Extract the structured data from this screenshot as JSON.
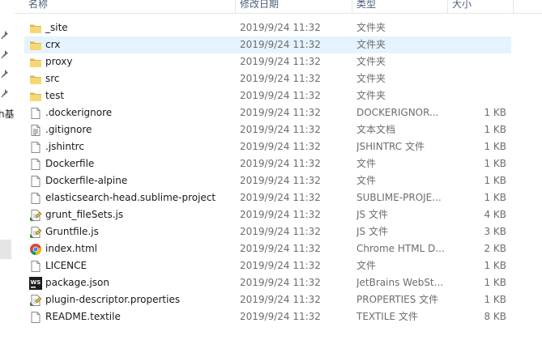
{
  "nav": {
    "cut_label": "h基"
  },
  "columns": {
    "name": "名称",
    "date": "修改日期",
    "type": "类型",
    "size": "大小"
  },
  "files": [
    {
      "name": "_site",
      "date": "2019/9/24 11:32",
      "type": "文件夹",
      "size": "",
      "icon": "folder-icon"
    },
    {
      "name": "crx",
      "date": "2019/9/24 11:32",
      "type": "文件夹",
      "size": "",
      "icon": "folder-icon",
      "selected": true
    },
    {
      "name": "proxy",
      "date": "2019/9/24 11:32",
      "type": "文件夹",
      "size": "",
      "icon": "folder-icon"
    },
    {
      "name": "src",
      "date": "2019/9/24 11:32",
      "type": "文件夹",
      "size": "",
      "icon": "folder-icon"
    },
    {
      "name": "test",
      "date": "2019/9/24 11:32",
      "type": "文件夹",
      "size": "",
      "icon": "folder-icon"
    },
    {
      "name": ".dockerignore",
      "date": "2019/9/24 11:32",
      "type": "DOCKERIGNOR...",
      "size": "1 KB",
      "icon": "blank-file-icon"
    },
    {
      "name": ".gitignore",
      "date": "2019/9/24 11:32",
      "type": "文本文档",
      "size": "1 KB",
      "icon": "text-file-icon"
    },
    {
      "name": ".jshintrc",
      "date": "2019/9/24 11:32",
      "type": "JSHINTRC 文件",
      "size": "1 KB",
      "icon": "blank-file-icon"
    },
    {
      "name": "Dockerfile",
      "date": "2019/9/24 11:32",
      "type": "文件",
      "size": "1 KB",
      "icon": "blank-file-icon"
    },
    {
      "name": "Dockerfile-alpine",
      "date": "2019/9/24 11:32",
      "type": "文件",
      "size": "1 KB",
      "icon": "blank-file-icon"
    },
    {
      "name": "elasticsearch-head.sublime-project",
      "date": "2019/9/24 11:32",
      "type": "SUBLIME-PROJE...",
      "size": "1 KB",
      "icon": "blank-file-icon"
    },
    {
      "name": "grunt_fileSets.js",
      "date": "2019/9/24 11:32",
      "type": "JS 文件",
      "size": "4 KB",
      "icon": "script-file-icon"
    },
    {
      "name": "Gruntfile.js",
      "date": "2019/9/24 11:32",
      "type": "JS 文件",
      "size": "3 KB",
      "icon": "script-file-icon"
    },
    {
      "name": "index.html",
      "date": "2019/9/24 11:32",
      "type": "Chrome HTML D...",
      "size": "2 KB",
      "icon": "chrome-icon"
    },
    {
      "name": "LICENCE",
      "date": "2019/9/24 11:32",
      "type": "文件",
      "size": "1 KB",
      "icon": "blank-file-icon"
    },
    {
      "name": "package.json",
      "date": "2019/9/24 11:32",
      "type": "JetBrains WebSt...",
      "size": "1 KB",
      "icon": "webstorm-icon"
    },
    {
      "name": "plugin-descriptor.properties",
      "date": "2019/9/24 11:32",
      "type": "PROPERTIES 文件",
      "size": "1 KB",
      "icon": "script-file-icon"
    },
    {
      "name": "README.textile",
      "date": "2019/9/24 11:32",
      "type": "TEXTILE 文件",
      "size": "8 KB",
      "icon": "blank-file-icon"
    }
  ]
}
